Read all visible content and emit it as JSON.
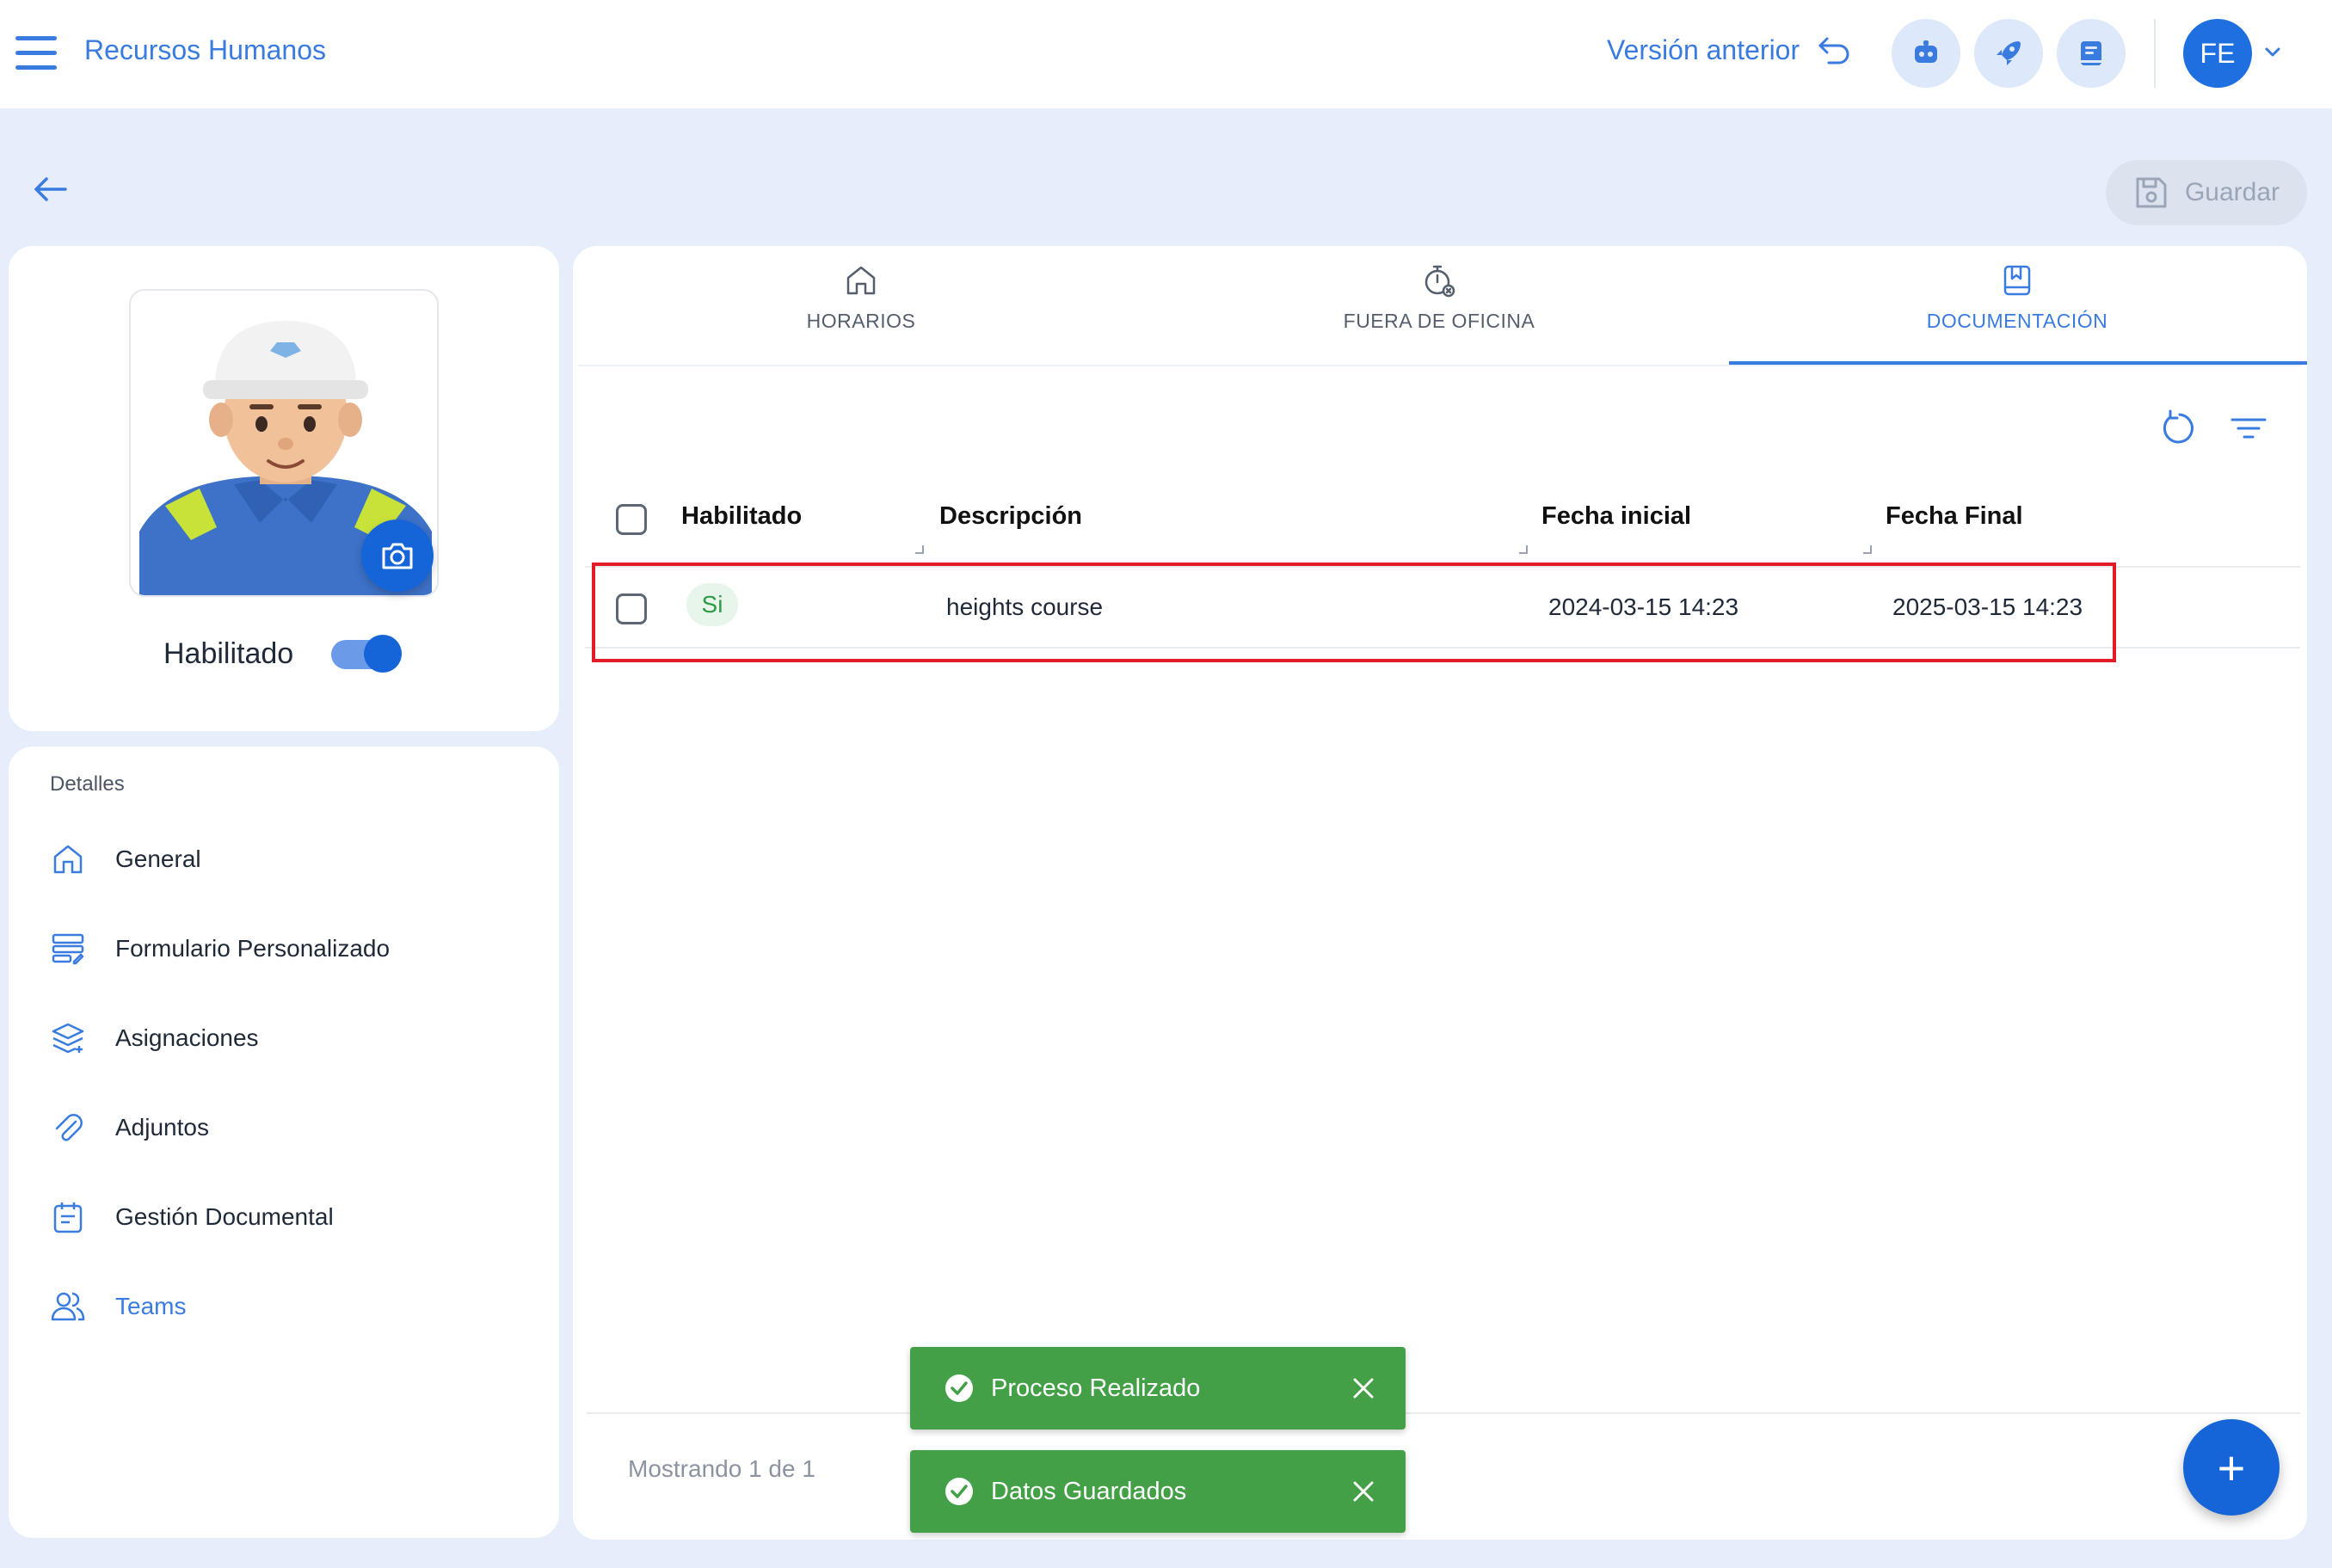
{
  "header": {
    "menu_icon": "hamburger-menu-icon",
    "app_title": "Recursos Humanos",
    "prev_version_label": "Versión anterior",
    "prev_version_icon": "undo-arrow-icon",
    "action_icons": [
      "robot-icon",
      "rocket-icon",
      "book-icon"
    ],
    "user_initials": "FE",
    "user_menu_icon": "chevron-down-icon"
  },
  "subheader": {
    "back_icon": "arrow-left-icon",
    "save_label": "Guardar",
    "save_icon": "floppy-disk-icon"
  },
  "profile": {
    "photo_alt": "worker-avatar",
    "camera_icon": "camera-icon",
    "enabled_label": "Habilitado",
    "enabled": true
  },
  "details": {
    "title": "Detalles",
    "items": [
      {
        "label": "General",
        "icon": "home-icon"
      },
      {
        "label": "Formulario Personalizado",
        "icon": "form-edit-icon"
      },
      {
        "label": "Asignaciones",
        "icon": "layers-icon"
      },
      {
        "label": "Adjuntos",
        "icon": "paperclip-icon"
      },
      {
        "label": "Gestión Documental",
        "icon": "clipboard-icon"
      },
      {
        "label": "Teams",
        "icon": "users-icon",
        "active": true
      }
    ]
  },
  "tabs": [
    {
      "label": "HORARIOS",
      "icon": "home-icon"
    },
    {
      "label": "FUERA DE OFICINA",
      "icon": "timer-icon"
    },
    {
      "label": "DOCUMENTACIÓN",
      "icon": "bookmark-book-icon",
      "active": true
    }
  ],
  "toolbar": {
    "refresh_icon": "refresh-icon",
    "filter_icon": "filter-lines-icon"
  },
  "table": {
    "columns": [
      "Habilitado",
      "Descripción",
      "Fecha inicial",
      "Fecha Final"
    ],
    "rows": [
      {
        "enabled": "Si",
        "description": "heights course",
        "start": "2024-03-15 14:23",
        "end": "2025-03-15 14:23"
      }
    ],
    "showing": "Mostrando 1 de 1"
  },
  "fab_label": "+",
  "toasts": [
    {
      "text": "Proceso Realizado",
      "icon": "check-circle-icon"
    },
    {
      "text": "Datos Guardados",
      "icon": "check-circle-icon"
    }
  ],
  "colors": {
    "accent": "#3a7be0",
    "primary": "#1565d8",
    "background": "#e6eefc",
    "success": "#43a047",
    "highlight": "#e21b24"
  }
}
